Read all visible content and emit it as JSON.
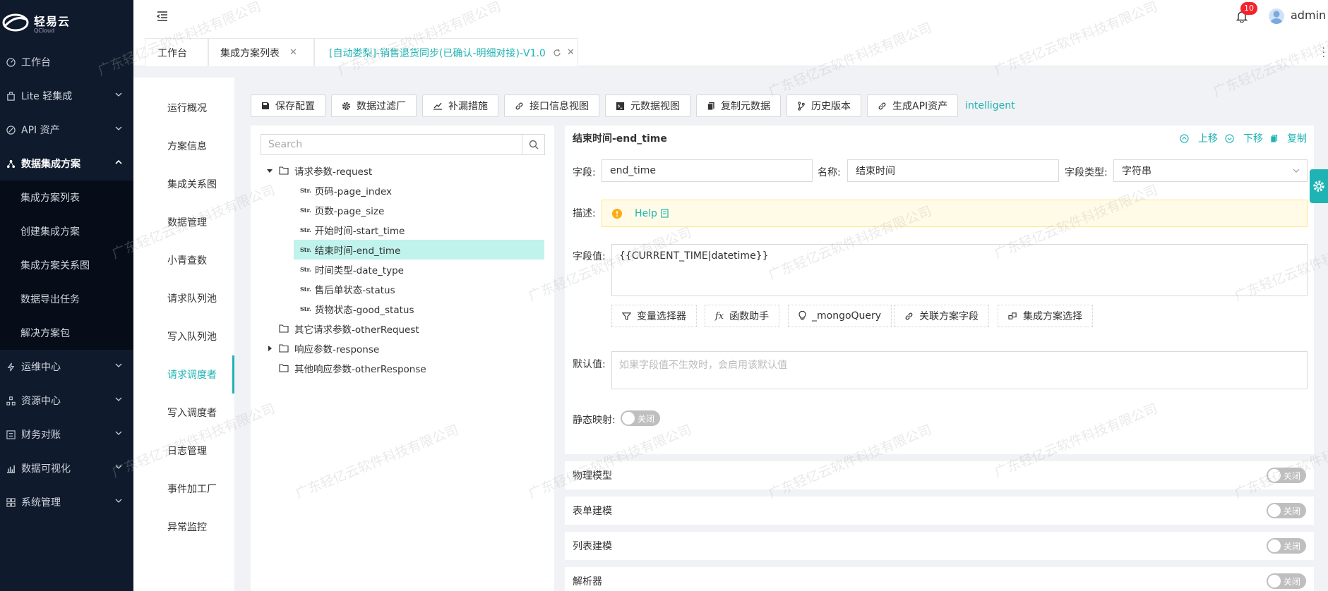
{
  "brand": {
    "name": "轻易云",
    "sub": "QCloud"
  },
  "sidebar": {
    "items": [
      {
        "label": "工作台",
        "icon": "dashboard-icon"
      },
      {
        "label": "Lite 轻集成",
        "icon": "lite-icon"
      },
      {
        "label": "API 资产",
        "icon": "api-icon"
      },
      {
        "label": "数据集成方案",
        "icon": "integration-icon"
      },
      {
        "label": "运维中心",
        "icon": "ops-icon"
      },
      {
        "label": "资源中心",
        "icon": "resource-icon"
      },
      {
        "label": "财务对账",
        "icon": "finance-icon"
      },
      {
        "label": "数据可视化",
        "icon": "chart-icon"
      },
      {
        "label": "系统管理",
        "icon": "system-icon"
      }
    ],
    "submenu": [
      "集成方案列表",
      "创建集成方案",
      "集成方案关系图",
      "数据导出任务",
      "解决方案包"
    ]
  },
  "header": {
    "notifications": "10",
    "username": "admin"
  },
  "tabs": [
    {
      "label": "工作台"
    },
    {
      "label": "集成方案列表"
    },
    {
      "label": "[自动娄梨]-销售退货同步(已确认-明细对接)-V1.0"
    }
  ],
  "leftnav": [
    "运行概况",
    "方案信息",
    "集成关系图",
    "数据管理",
    "小青查数",
    "请求队列池",
    "写入队列池",
    "请求调度者",
    "写入调度者",
    "日志管理",
    "事件加工厂",
    "异常监控"
  ],
  "toolbar": {
    "buttons": [
      "保存配置",
      "数据过滤厂",
      "补漏措施",
      "接口信息视图",
      "元数据视图",
      "复制元数据",
      "历史版本",
      "生成API资产"
    ],
    "intelligent": "intelligent"
  },
  "tree": {
    "search_placeholder": "Search",
    "str_tag": "Str.",
    "request": "请求参数-request",
    "request_children": [
      "页码-page_index",
      "页数-page_size",
      "开始时间-start_time",
      "结束时间-end_time",
      "时间类型-date_type",
      "售后单状态-status",
      "货物状态-good_status"
    ],
    "others": [
      "其它请求参数-otherRequest",
      "响应参数-response",
      "其他响应参数-otherResponse"
    ]
  },
  "detail": {
    "title": "结束时间-end_time",
    "actions": {
      "up": "上移",
      "down": "下移",
      "copy": "复制"
    },
    "field_label": "字段:",
    "field_value": "end_time",
    "name_label": "名称:",
    "name_value": "结束时间",
    "type_label": "字段类型:",
    "type_value": "字符串",
    "desc_label": "描述:",
    "help": "Help",
    "value_label": "字段值:",
    "value": "{{CURRENT_TIME|datetime}}",
    "helper_buttons": [
      "变量选择器",
      "函数助手",
      "_mongoQuery",
      "关联方案字段",
      "集成方案选择"
    ],
    "default_label": "默认值:",
    "default_placeholder": "如果字段值不生效时，会启用该默认值",
    "static_label": "静态映射:",
    "static_switch": "关闭"
  },
  "panels": [
    {
      "label": "物理模型",
      "switch": "关闭"
    },
    {
      "label": "表单建模",
      "switch": "关闭"
    },
    {
      "label": "列表建模",
      "switch": "关闭"
    },
    {
      "label": "解析器",
      "switch": "关闭"
    }
  ],
  "watermark": "广东轻亿云软件科技有限公司"
}
